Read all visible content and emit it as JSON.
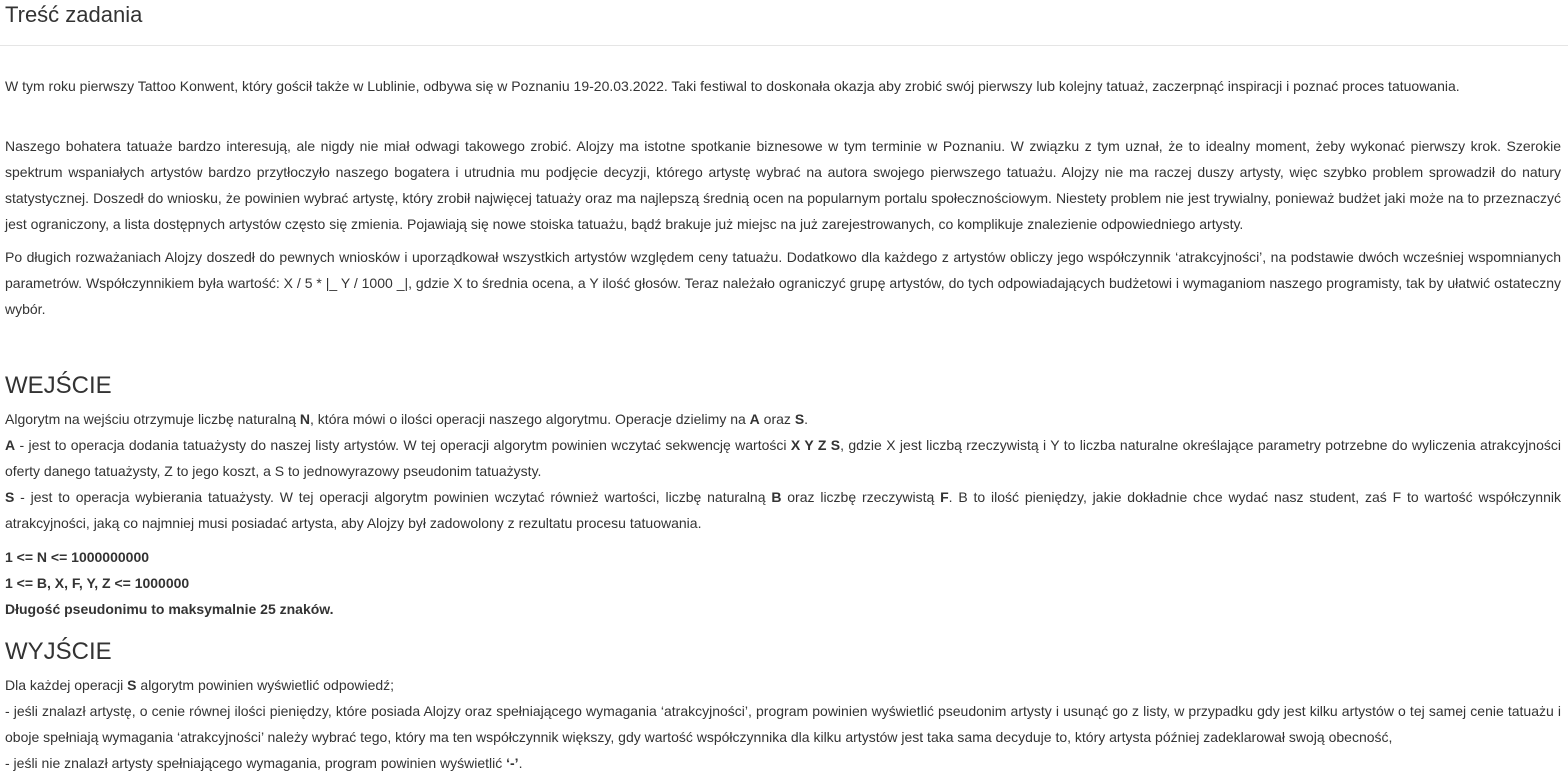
{
  "title": "Treść zadania",
  "intro": {
    "p1": "W tym roku pierwszy Tattoo Konwent, który gościł także w Lublinie, odbywa się w Poznaniu 19-20.03.2022. Taki festiwal to doskonała okazja aby zrobić swój pierwszy lub kolejny tatuaż, zaczerpnąć inspiracji i poznać proces tatuowania.",
    "p2": "Naszego bohatera tatuaże bardzo interesują, ale nigdy nie miał odwagi takowego zrobić. Alojzy ma istotne spotkanie biznesowe w tym terminie w Poznaniu. W związku z tym uznał, że to idealny moment, żeby wykonać pierwszy krok. Szerokie spektrum wspaniałych artystów bardzo przytłoczyło naszego bogatera i utrudnia mu podjęcie decyzji, którego artystę wybrać na autora swojego pierwszego tatuażu. Alojzy nie ma raczej duszy artysty, więc szybko problem sprowadził do natury statystycznej. Doszedł do wniosku, że powinien wybrać artystę, który zrobił najwięcej tatuaży oraz ma najlepszą średnią ocen na popularnym portalu społecznościowym. Niestety problem nie jest trywialny, ponieważ budżet jaki może na to przeznaczyć jest ograniczony, a lista dostępnych artystów często się zmienia. Pojawiają się nowe stoiska tatuażu, bądź brakuje już miejsc na już zarejestrowanych, co komplikuje znalezienie odpowiedniego artysty.",
    "p3": "Po długich rozważaniach Alojzy doszedł do pewnych wniosków i uporządkował wszystkich artystów względem ceny tatuażu. Dodatkowo dla każdego z artystów obliczy jego współczynnik ‘atrakcyjności’, na podstawie dwóch wcześniej wspomnianych parametrów. Współczynnikiem była wartość: X / 5 * |_ Y / 1000 _|, gdzie X to średnia ocena, a Y ilość głosów. Teraz należało ograniczyć grupę artystów, do tych odpowiadających budżetowi i wymaganiom naszego programisty, tak by ułatwić ostateczny wybór."
  },
  "input": {
    "heading": "WEJŚCIE",
    "l1_a": "Algorytm na wejściu otrzymuje liczbę naturalną ",
    "l1_b": "N",
    "l1_c": ", która mówi o ilości operacji naszego algorytmu. Operacje dzielimy na ",
    "l1_d": "A",
    "l1_e": " oraz ",
    "l1_f": "S",
    "l1_g": ".",
    "a_key": "A",
    "a_1": " - jest to operacja dodania tatuażysty do naszej listy artystów. W tej operacji algorytm powinien wczytać sekwencję wartości ",
    "a_2": "X Y Z S",
    "a_3": ", gdzie X jest liczbą rzeczywistą i Y to liczba naturalne określające parametry potrzebne do wyliczenia atrakcyjności oferty danego tatuażysty, Z to jego koszt, a S to jednowyrazowy pseudonim tatuażysty.",
    "s_key": "S",
    "s_1": " - jest to operacja wybierania tatuażysty. W tej operacji algorytm powinien wczytać również wartości, liczbę naturalną ",
    "s_2": "B",
    "s_3": " oraz liczbę rzeczywistą ",
    "s_4": "F",
    "s_5": ". B to ilość pieniędzy, jakie dokładnie chce wydać nasz student, zaś F to wartość współczynnik atrakcyjności, jaką co najmniej musi posiadać artysta, aby Alojzy był zadowolony z rezultatu procesu tatuowania.",
    "c1": "1 <= N <= 1000000000",
    "c2": "1 <= B, X, F, Y, Z <= 1000000",
    "c3": "Długość pseudonimu to maksymalnie 25 znaków."
  },
  "output": {
    "heading": "WYJŚCIE",
    "l1_a": "Dla każdej operacji ",
    "l1_b": "S",
    "l1_c": " algorytm powinien wyświetlić odpowiedź;",
    "l2": "- jeśli znalazł artystę, o cenie równej ilości pieniędzy, które posiada Alojzy oraz spełniającego wymagania ‘atrakcyjności’, program powinien wyświetlić pseudonim artysty i usunąć go z listy, w przypadku gdy jest kilku artystów o tej samej cenie tatuażu i oboje spełniają wymagania ‘atrakcyjności’ należy wybrać tego, który ma ten współczynnik większy, gdy wartość współczynnika dla kilku artystów jest taka sama decyduje to, który artysta później zadeklarował swoją obecność,",
    "l3_a": "- jeśli nie znalazł artysty spełniającego wymagania, program powinien wyświetlić ",
    "l3_b": "‘-’",
    "l3_c": "."
  }
}
